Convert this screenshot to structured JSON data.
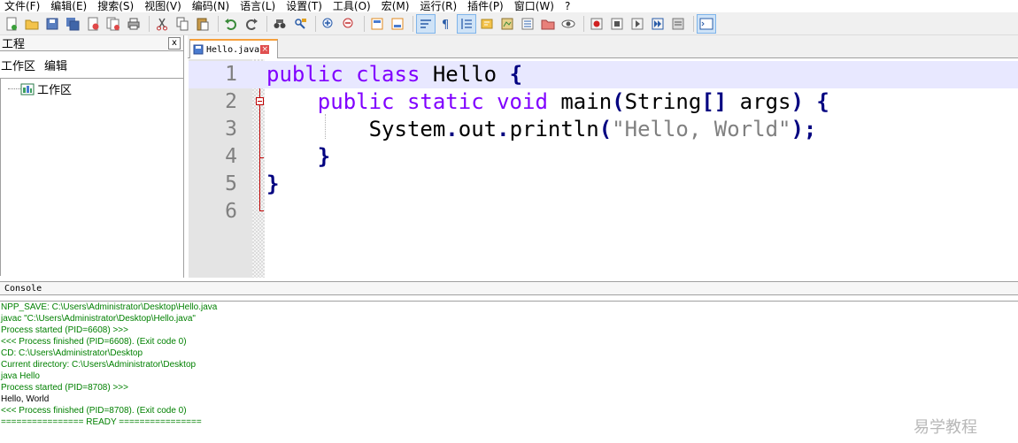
{
  "menubar": {
    "items": [
      "文件(F)",
      "编辑(E)",
      "搜索(S)",
      "视图(V)",
      "编码(N)",
      "语言(L)",
      "设置(T)",
      "工具(O)",
      "宏(M)",
      "运行(R)",
      "插件(P)",
      "窗口(W)",
      "?"
    ]
  },
  "toolbar": {
    "icons": [
      "new-file-icon",
      "open-file-icon",
      "save-icon",
      "save-all-icon",
      "close-icon",
      "close-all-icon",
      "print-icon",
      "cut-icon",
      "copy-icon",
      "paste-icon",
      "undo-icon",
      "redo-icon",
      "find-icon",
      "replace-icon",
      "zoom-in-icon",
      "zoom-out-icon",
      "sync-v-icon",
      "sync-h-icon",
      "word-wrap-icon",
      "show-all-chars-icon",
      "indent-guide-icon",
      "user-lang-icon",
      "doc-map-icon",
      "function-list-icon",
      "folder-workspace-icon",
      "monitor-icon",
      "record-macro-icon",
      "stop-macro-icon",
      "play-macro-icon",
      "run-macro-multi-icon",
      "save-macro-icon",
      "console-icon"
    ]
  },
  "project": {
    "title": "工程",
    "close": "x",
    "menu_workspace": "工作区",
    "menu_edit": "编辑",
    "tree_root": "工作区"
  },
  "editor": {
    "tab_label": "Hello.java",
    "lines": [
      {
        "num": "1"
      },
      {
        "num": "2"
      },
      {
        "num": "3"
      },
      {
        "num": "4"
      },
      {
        "num": "5"
      },
      {
        "num": "6"
      }
    ],
    "code": {
      "l1_kw1": "public",
      "l1_kw2": "class",
      "l1_name": "Hello",
      "l1_brace": "{",
      "l2_kw1": "public",
      "l2_kw2": "static",
      "l2_kw3": "void",
      "l2_name": "main",
      "l2_paren_open": "(",
      "l2_type": "String",
      "l2_brackets": "[]",
      "l2_arg": "args",
      "l2_paren_close": ")",
      "l2_brace": "{",
      "l3_obj": "System",
      "l3_dot1": ".",
      "l3_field": "out",
      "l3_dot2": ".",
      "l3_method": "println",
      "l3_paren_open": "(",
      "l3_string": "\"Hello, World\"",
      "l3_paren_close": ")",
      "l3_semi": ";",
      "l4_brace": "}",
      "l5_brace": "}"
    }
  },
  "console": {
    "title": "Console",
    "lines": [
      {
        "text": "NPP_SAVE: C:\\Users\\Administrator\\Desktop\\Hello.java",
        "color": "green"
      },
      {
        "text": "javac \"C:\\Users\\Administrator\\Desktop\\Hello.java\"",
        "color": "green"
      },
      {
        "text": "Process started (PID=6608) >>>",
        "color": "green"
      },
      {
        "text": "<<< Process finished (PID=6608). (Exit code 0)",
        "color": "green"
      },
      {
        "text": "CD: C:\\Users\\Administrator\\Desktop",
        "color": "green"
      },
      {
        "text": "Current directory: C:\\Users\\Administrator\\Desktop",
        "color": "green"
      },
      {
        "text": "java Hello",
        "color": "green"
      },
      {
        "text": "Process started (PID=8708) >>>",
        "color": "green"
      },
      {
        "text": "Hello, World",
        "color": "black"
      },
      {
        "text": "<<< Process finished (PID=8708). (Exit code 0)",
        "color": "green"
      },
      {
        "text": "================ READY ================",
        "color": "green"
      }
    ]
  },
  "watermark": "易学教程",
  "colors": {
    "keyword": "#8000ff",
    "operator": "#000080",
    "string": "#808080",
    "console_green": "#008000",
    "current_line": "#e8e8ff",
    "fold_marker": "#c00000"
  }
}
